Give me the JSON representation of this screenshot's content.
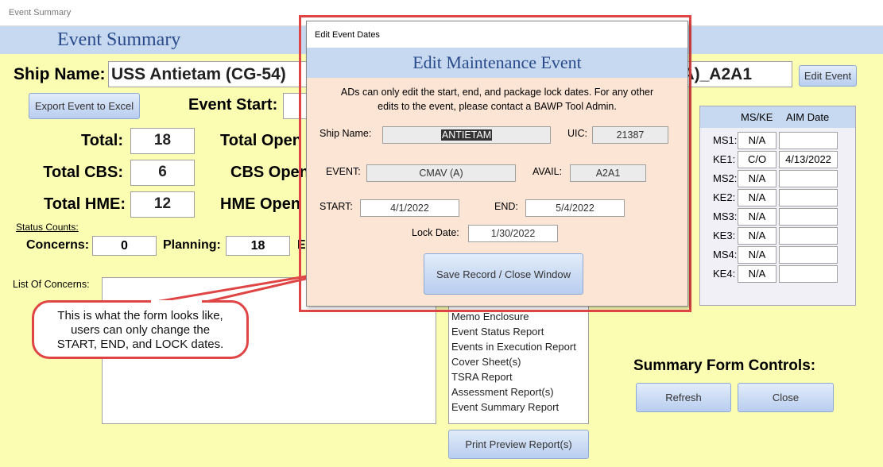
{
  "window": {
    "title": "Event Summary"
  },
  "header": {
    "title": "Event Summary"
  },
  "form": {
    "ship_name_label": "Ship Name:",
    "ship_name_value": "USS Antietam (CG-54)",
    "event_name_visible": "A)_A2A1",
    "edit_event_button": "Edit Event",
    "export_button": "Export Event to Excel",
    "event_start_label": "Event Start:",
    "totals": [
      {
        "label": "Total:",
        "value": "18",
        "open_label": "Total Open"
      },
      {
        "label": "Total CBS:",
        "value": "6",
        "open_label": "CBS Open"
      },
      {
        "label": "Total HME:",
        "value": "12",
        "open_label": "HME Open"
      }
    ],
    "status_counts_label": "Status Counts:",
    "concerns_label": "Concerns:",
    "concerns_value": "0",
    "planning_label": "Planning:",
    "planning_value": "18",
    "next_label_partial": "E",
    "list_of_concerns_label": "List Of Concerns:",
    "reports": [
      "Memo Enclosure",
      "Event Status Report",
      "Events in Execution Report",
      "Cover Sheet(s)",
      "TSRA Report",
      "Assessment Report(s)",
      "Event Summary Report"
    ],
    "print_preview_button": "Print Preview Report(s)",
    "milestones": {
      "header_ms": "MS/KE",
      "header_aim": "AIM Date",
      "rows": [
        {
          "label": "MS1:",
          "status": "N/A",
          "date": ""
        },
        {
          "label": "KE1:",
          "status": "C/O",
          "date": "4/13/2022"
        },
        {
          "label": "MS2:",
          "status": "N/A",
          "date": ""
        },
        {
          "label": "KE2:",
          "status": "N/A",
          "date": ""
        },
        {
          "label": "MS3:",
          "status": "N/A",
          "date": ""
        },
        {
          "label": "KE3:",
          "status": "N/A",
          "date": ""
        },
        {
          "label": "MS4:",
          "status": "N/A",
          "date": ""
        },
        {
          "label": "KE4:",
          "status": "N/A",
          "date": ""
        }
      ]
    },
    "summary_controls_label": "Summary Form Controls:",
    "refresh_button": "Refresh",
    "close_button": "Close"
  },
  "dialog": {
    "window_title": "Edit Event Dates",
    "heading": "Edit Maintenance Event",
    "note_line1": "ADs can only edit the start, end, and package lock dates. For any other",
    "note_line2": "edits to the event, please contact a BAWP Tool Admin.",
    "ship_name_label": "Ship Name:",
    "ship_name_value": "ANTIETAM",
    "uic_label": "UIC:",
    "uic_value": "21387",
    "event_label": "EVENT:",
    "event_value": "CMAV (A)",
    "avail_label": "AVAIL:",
    "avail_value": "A2A1",
    "start_label": "START:",
    "start_value": "4/1/2022",
    "end_label": "END:",
    "end_value": "5/4/2022",
    "lock_label": "Lock Date:",
    "lock_value": "1/30/2022",
    "save_button": "Save Record / Close Window"
  },
  "callout": {
    "line1": "This is what the form looks like,",
    "line2": "users can only change the",
    "line3": "START, END, and LOCK dates.",
    "color": "#e04545"
  }
}
